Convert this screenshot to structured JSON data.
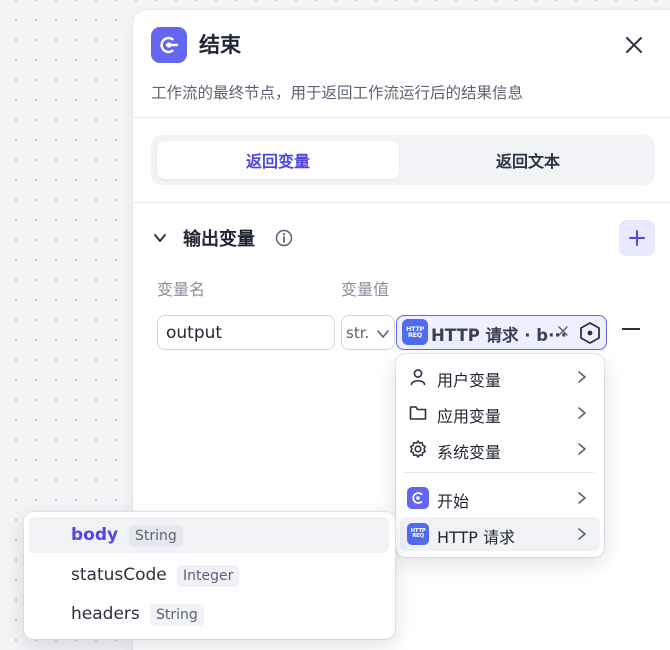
{
  "node": {
    "title": "结束",
    "description": "工作流的最终节点，用于返回工作流运行后的结果信息"
  },
  "tabs": [
    {
      "label": "返回变量",
      "active": true
    },
    {
      "label": "返回文本",
      "active": false
    }
  ],
  "output_section": {
    "title": "输出变量",
    "col_name": "变量名",
    "col_value": "变量值",
    "row": {
      "name": "output",
      "type": "str.",
      "value_source": "HTTP 请求",
      "value_text": "HTTP 请求 · b···"
    }
  },
  "badge": {
    "line1": "HTTP",
    "line2": "REQ"
  },
  "menu": {
    "items": [
      {
        "label": "用户变量",
        "icon": "user-icon"
      },
      {
        "label": "应用变量",
        "icon": "folder-icon"
      },
      {
        "label": "系统变量",
        "icon": "gear-icon"
      },
      {
        "label": "开始",
        "icon": "start-node-icon"
      },
      {
        "label": "HTTP 请求",
        "icon": "http-node-icon"
      }
    ]
  },
  "submenu": {
    "items": [
      {
        "name": "body",
        "type": "String",
        "selected": true
      },
      {
        "name": "statusCode",
        "type": "Integer",
        "selected": false
      },
      {
        "name": "headers",
        "type": "String",
        "selected": false
      }
    ]
  },
  "colors": {
    "accent": "#6366f1",
    "http_blue": "#4f6bf0"
  }
}
